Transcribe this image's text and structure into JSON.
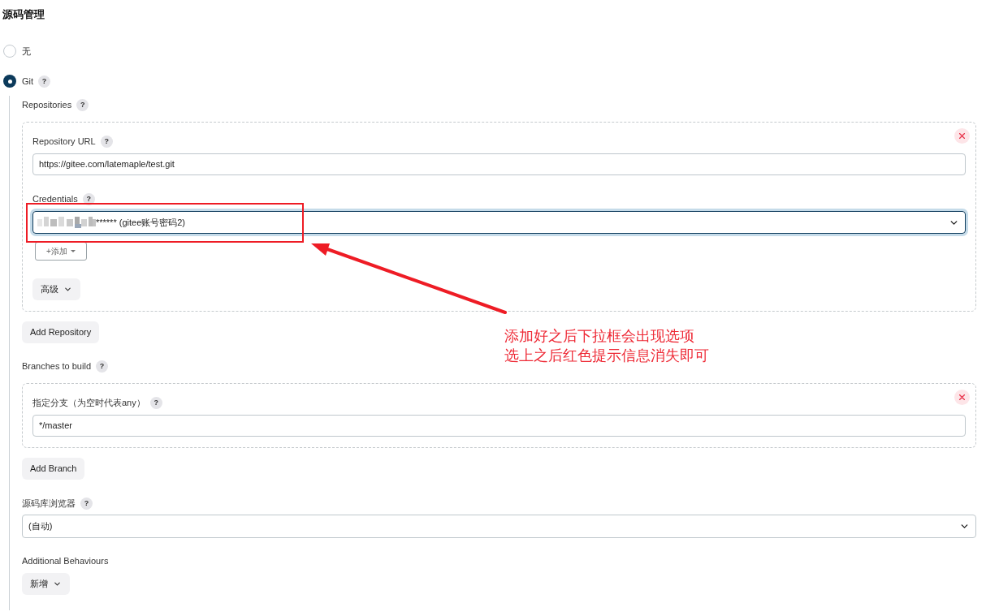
{
  "section": {
    "title": "源码管理"
  },
  "scm_options": [
    {
      "label": "无",
      "selected": false
    },
    {
      "label": "Git",
      "selected": true,
      "help": "?"
    }
  ],
  "git": {
    "repositories": {
      "label": "Repositories",
      "help": "?",
      "items": [
        {
          "url_label": "Repository URL",
          "url_help": "?",
          "url": "https://gitee.com/latemaple/test.git",
          "credentials_label": "Credentials",
          "credentials_help": "?",
          "credentials": {
            "value": "****** (gitee账号密码2)",
            "redacted": true,
            "focused": true
          },
          "add_button": "+添加",
          "advanced_button": "高级"
        }
      ],
      "add_button": "Add Repository"
    },
    "branches": {
      "label": "Branches to build",
      "help": "?",
      "items": [
        {
          "label": "指定分支（为空时代表any）",
          "help": "?",
          "value": "*/master"
        }
      ],
      "add_button": "Add Branch"
    },
    "browser": {
      "label": "源码库浏览器",
      "help": "?",
      "value": "(自动)",
      "focused": false
    },
    "behaviours": {
      "label": "Additional Behaviours",
      "add_button": "新增"
    }
  },
  "annotation": {
    "lines": [
      "添加好之后下拉框会出现选项",
      "选上之后红色提示信息消失即可"
    ]
  }
}
